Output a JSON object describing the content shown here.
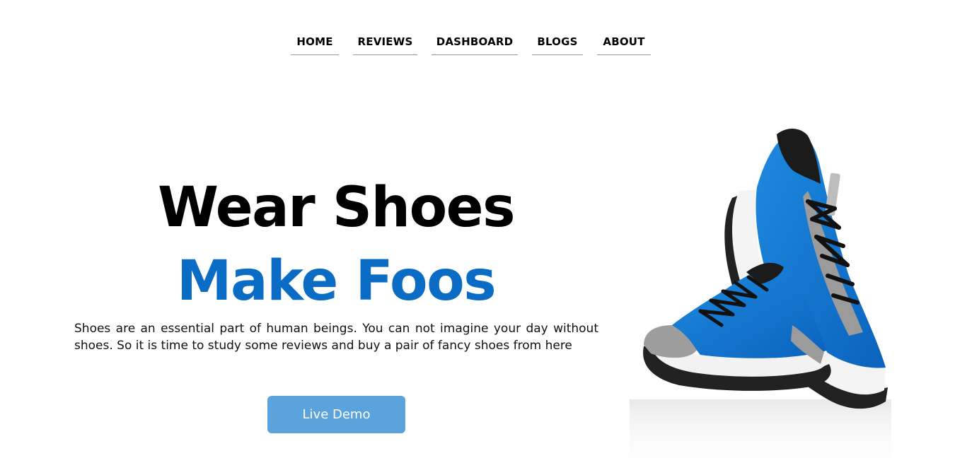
{
  "nav": {
    "items": [
      {
        "label": "HOME"
      },
      {
        "label": "REVIEWS"
      },
      {
        "label": "DASHBOARD"
      },
      {
        "label": "BLOGS"
      },
      {
        "label": "ABOUT"
      }
    ]
  },
  "hero": {
    "headline_line1": "Wear Shoes",
    "headline_line2": "Make Foos",
    "description": "Shoes are an essential part of human beings. You can not imagine your day without shoes. So it is time to study some reviews and buy a pair of fancy shoes from here",
    "button_label": "Live Demo",
    "image_icon": "blue-running-shoes-image"
  },
  "colors": {
    "accent_blue": "#0a6cc4",
    "button_blue": "#5ba3dd",
    "nav_underline": "#9a9a9a",
    "shoe_blue": "#1a7fd6",
    "shoe_gray": "#9a9a9a"
  }
}
